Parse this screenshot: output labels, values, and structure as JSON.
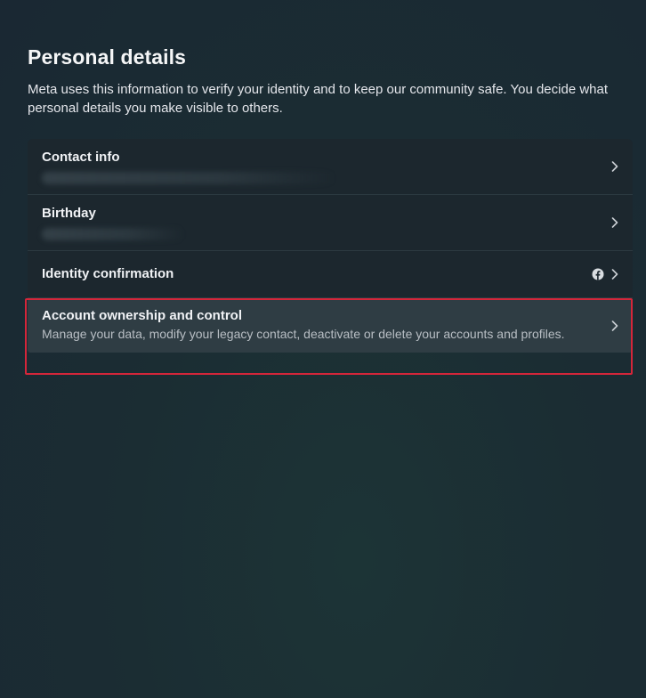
{
  "header": {
    "title": "Personal details",
    "description": "Meta uses this information to verify your identity and to keep our community safe. You decide what personal details you make visible to others."
  },
  "settings": {
    "items": [
      {
        "label": "Contact info",
        "sub": "",
        "icon": "chevron-right-icon"
      },
      {
        "label": "Birthday",
        "sub": "",
        "icon": "chevron-right-icon"
      },
      {
        "label": "Identity confirmation",
        "sub": "",
        "icon": "chevron-right-icon",
        "badge_icon": "facebook-icon"
      },
      {
        "label": "Account ownership and control",
        "sub": "Manage your data, modify your legacy contact, deactivate or delete your accounts and profiles.",
        "icon": "chevron-right-icon"
      }
    ]
  },
  "colors": {
    "highlight_border": "#d4263a",
    "selected_row_bg": "#2f3d44",
    "card_bg": "#1c272e"
  }
}
